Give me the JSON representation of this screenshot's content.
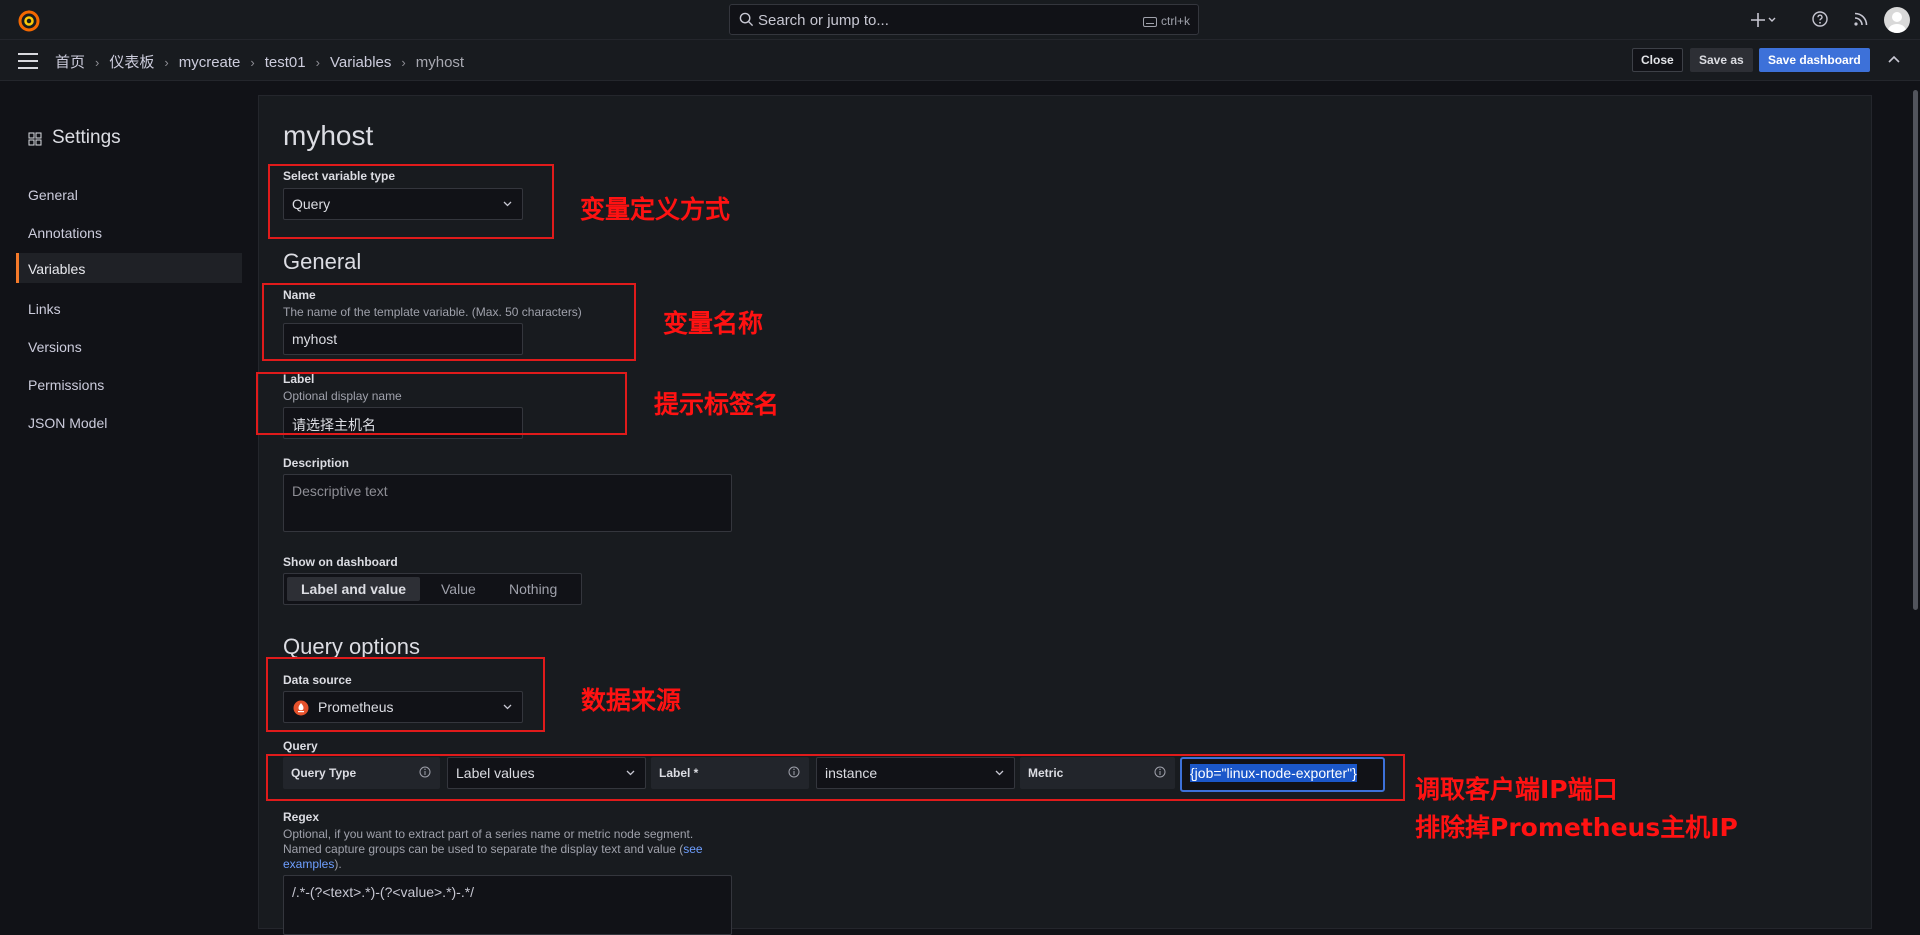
{
  "search": {
    "placeholder": "Search or jump to...",
    "shortcut": "ctrl+k"
  },
  "breadcrumb": [
    "首页",
    "仪表板",
    "mycreate",
    "test01",
    "Variables",
    "myhost"
  ],
  "toolbar": {
    "close": "Close",
    "save_as": "Save as",
    "save_dashboard": "Save dashboard"
  },
  "sidebar": {
    "title": "Settings",
    "items": [
      {
        "label": "General",
        "active": false
      },
      {
        "label": "Annotations",
        "active": false
      },
      {
        "label": "Variables",
        "active": true
      },
      {
        "label": "Links",
        "active": false
      },
      {
        "label": "Versions",
        "active": false
      },
      {
        "label": "Permissions",
        "active": false
      },
      {
        "label": "JSON Model",
        "active": false
      }
    ]
  },
  "editor": {
    "title": "myhost",
    "type_label": "Select variable type",
    "type_value": "Query",
    "general_heading": "General",
    "name_label": "Name",
    "name_desc": "The name of the template variable. (Max. 50 characters)",
    "name_value": "myhost",
    "label_label": "Label",
    "label_desc": "Optional display name",
    "label_value": "请选择主机名",
    "description_label": "Description",
    "description_placeholder": "Descriptive text",
    "show_label": "Show on dashboard",
    "show_options": [
      "Label and value",
      "Value",
      "Nothing"
    ],
    "show_selected": "Label and value",
    "query_options_heading": "Query options",
    "datasource_label": "Data source",
    "datasource_value": "Prometheus",
    "query_label": "Query",
    "query_type_label": "Query Type",
    "query_type_value": "Label values",
    "label_field_label": "Label *",
    "label_field_value": "instance",
    "metric_label": "Metric",
    "metric_value": "{job=\"linux-node-exporter\"}",
    "regex_label": "Regex",
    "regex_desc1": "Optional, if you want to extract part of a series name or metric node segment.",
    "regex_desc2_pre": "Named capture groups can be used to separate the display text and value (",
    "regex_desc2_link": "see",
    "regex_desc3_link": "examples",
    "regex_desc3_post": ").",
    "regex_value": "/.*-(?<text>.*)-(?<value>.*)-.*/"
  },
  "annotations": {
    "type": "变量定义方式",
    "name": "变量名称",
    "label": "提示标签名",
    "datasource": "数据来源",
    "query_line1": "调取客户端IP端口",
    "query_line2": "排除掉Prometheus主机IP"
  },
  "colors": {
    "accent": "#3d71d9",
    "active_tab": "#f57a2a",
    "annotation": "#e01b1b"
  }
}
